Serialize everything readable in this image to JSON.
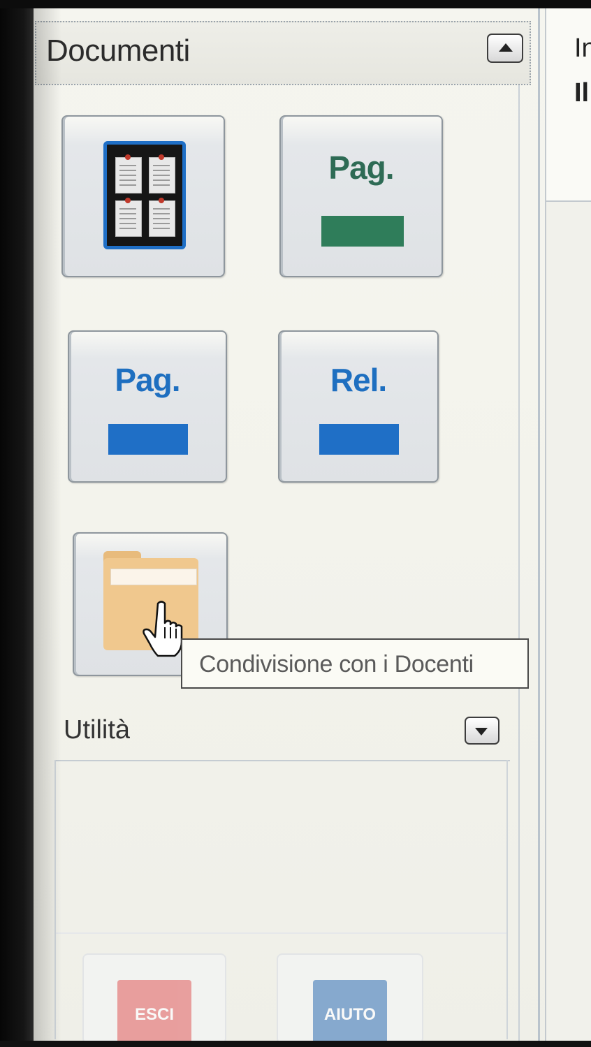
{
  "documenti": {
    "title": "Documenti",
    "tiles": [
      {
        "id": "bacheca",
        "icon": "bulletin-board-icon"
      },
      {
        "id": "pag-green",
        "label": "Pag.",
        "label_color": "#2e6b55",
        "bar_color": "#2f7d5a"
      },
      {
        "id": "pag-blue",
        "label": "Pag.",
        "label_color": "#1e6fc0",
        "bar_color": "#1f6fc6"
      },
      {
        "id": "rel-blue",
        "label": "Rel.",
        "label_color": "#1e6fc0",
        "bar_color": "#1f6fc6"
      },
      {
        "id": "condivisione",
        "icon": "folder-icon"
      }
    ]
  },
  "tooltip": {
    "text": "Condivisione con i Docenti"
  },
  "utilita": {
    "title": "Utilità",
    "buttons": [
      {
        "label": "ESCI",
        "color": "#e05a5a"
      },
      {
        "label": "AIUTO",
        "color": "#2f6eb3"
      }
    ]
  },
  "right_pane": {
    "line1": "In",
    "line2": "Il"
  },
  "colors": {
    "accent_blue": "#1f6fc6",
    "accent_green": "#2f7d5a",
    "folder": "#f0c88e"
  }
}
